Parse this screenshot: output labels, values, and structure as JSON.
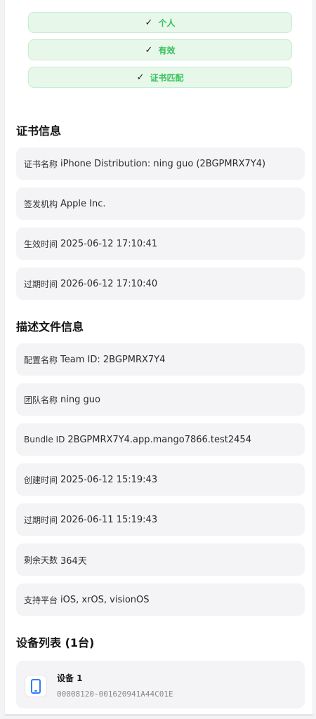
{
  "status_badges": [
    {
      "check": "✓",
      "label": "个人"
    },
    {
      "check": "✓",
      "label": "有效"
    },
    {
      "check": "✓",
      "label": "证书匹配"
    }
  ],
  "certificate": {
    "title": "证书信息",
    "rows": [
      {
        "label": "证书名称",
        "value": "iPhone Distribution: ning guo (2BGPMRX7Y4)"
      },
      {
        "label": "签发机构",
        "value": "Apple Inc."
      },
      {
        "label": "生效时间",
        "value": "2025-06-12 17:10:41"
      },
      {
        "label": "过期时间",
        "value": "2026-06-12 17:10:40"
      }
    ]
  },
  "profile": {
    "title": "描述文件信息",
    "rows": [
      {
        "label": "配置名称",
        "value": "Team ID: 2BGPMRX7Y4"
      },
      {
        "label": "团队名称",
        "value": "ning guo"
      },
      {
        "label": "Bundle ID",
        "value": "2BGPMRX7Y4.app.mango7866.test2454"
      },
      {
        "label": "创建时间",
        "value": "2025-06-12 15:19:43"
      },
      {
        "label": "过期时间",
        "value": "2026-06-11 15:19:43"
      },
      {
        "label": "剩余天数",
        "value": "364天"
      },
      {
        "label": "支持平台",
        "value": "iOS, xrOS, visionOS"
      }
    ]
  },
  "devices": {
    "title": "设备列表 (1台)",
    "items": [
      {
        "name": "设备 1",
        "udid": "00008120-001620941A44C01E",
        "icon": "phone-icon"
      }
    ]
  },
  "colors": {
    "success": "#34c159",
    "success_bg": "#e7f7ea",
    "accent": "#2f7cf6"
  }
}
